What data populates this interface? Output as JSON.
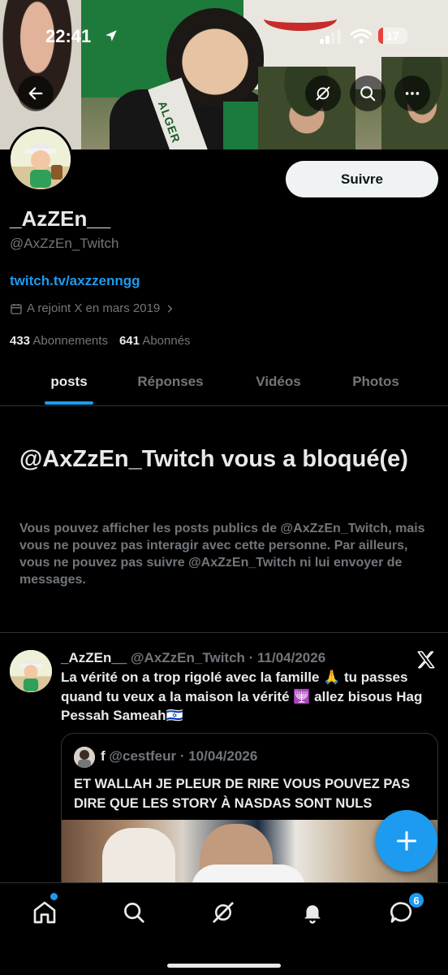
{
  "status_bar": {
    "time": "22:41",
    "battery": "17",
    "battery_fraction": 0.17
  },
  "banner": {
    "sash_text": "ALGER"
  },
  "profile": {
    "display_name": "_AzZEn__",
    "handle": "@AxZzEn_Twitch",
    "link": "twitch.tv/axzzenngg",
    "joined": "A rejoint X en mars 2019",
    "following_count": "433",
    "following_label": "Abonnements",
    "followers_count": "641",
    "followers_label": "Abonnés",
    "follow_label": "Suivre"
  },
  "tabs": [
    "posts",
    "Réponses",
    "Vidéos",
    "Photos"
  ],
  "blocked": {
    "title": "@AxZzEn_Twitch vous a bloqué(e)",
    "description": "Vous pouvez afficher les posts publics de @AxZzEn_Twitch, mais vous ne pouvez pas interagir avec cette personne. Par ailleurs, vous ne pouvez pas suivre @AxZzEn_Twitch ni lui envoyer de messages."
  },
  "tweet": {
    "name": "_AzZEn__",
    "meta": "@AxZzEn_Twitch · 11/04/2026",
    "text": "La vérité on a trop rigolé avec la famille 🙏 tu passes quand tu veux a la maison la vérité 🕎 allez bisous Hag Pessah Sameah🇮🇱",
    "quote": {
      "name": "f",
      "meta": "@cestfeur · 10/04/2026",
      "text": "ET WALLAH  JE PLEUR DE RIRE VOUS POUVEZ PAS DIRE QUE LES STORY À NASDAS SONT NULS"
    }
  },
  "nav": {
    "messages_badge": "6"
  },
  "colors": {
    "accent": "#1d9bf0",
    "background": "#000000",
    "text": "#e7e9ea",
    "muted": "#71767b",
    "battery_low": "#e5443d"
  },
  "icons": [
    "back-arrow-icon",
    "grok-icon",
    "search-icon",
    "more-icon",
    "calendar-icon",
    "chevron-right-icon",
    "x-logo-icon",
    "plus-icon",
    "home-icon",
    "search-icon",
    "grok-icon",
    "bell-icon",
    "messages-icon"
  ]
}
